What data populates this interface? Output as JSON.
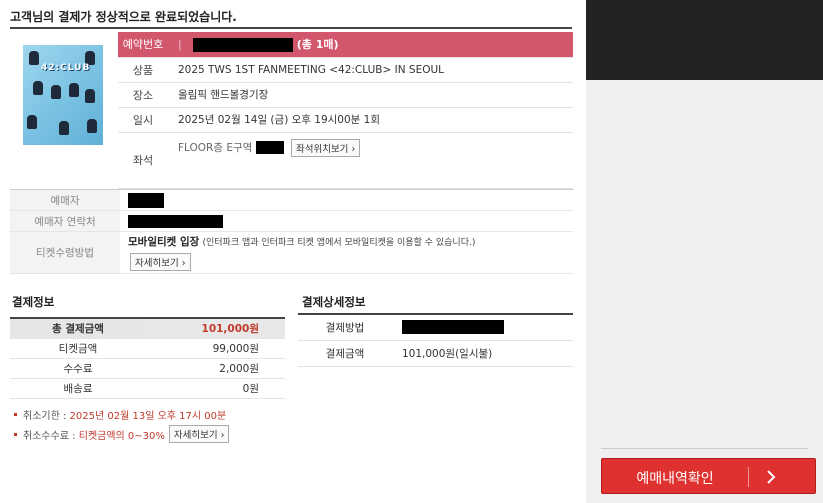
{
  "heading": "고객님의 결제가 정상적으로 완료되었습니다.",
  "poster": {
    "title": "42:CLUB"
  },
  "booking": {
    "number_label": "예약번호",
    "count_text": "(총 1매)",
    "rows": [
      {
        "label": "상품",
        "value": "2025 TWS 1ST FANMEETING <42:CLUB> IN SEOUL"
      },
      {
        "label": "장소",
        "value": "올림픽 핸드볼경기장"
      },
      {
        "label": "일시",
        "value": "2025년 02월 14일 (금) 오후 19시00분 1회"
      }
    ],
    "seat_label": "좌석",
    "seat_value": "FLOOR층 E구역",
    "seat_button": "좌석위치보기"
  },
  "buyer": {
    "name_label": "예매자",
    "contact_label": "예매자 연락처",
    "method_label": "티켓수령방법",
    "method_value": "모바일티켓 입장",
    "method_note": "(인터파크 앱과 인터파크 티켓 앱에서 모바일티켓을 이용할 수 있습니다.)",
    "detail_button": "자세히보기"
  },
  "payment": {
    "title": "결제정보",
    "total_label": "총 결제금액",
    "total_value": "101,000원",
    "rows": [
      {
        "label": "티켓금액",
        "value": "99,000원"
      },
      {
        "label": "수수료",
        "value": "2,000원"
      },
      {
        "label": "배송료",
        "value": "0원"
      }
    ]
  },
  "payment_detail": {
    "title": "결제상세정보",
    "method_label": "결제방법",
    "amount_label": "결제금액",
    "amount_value": "101,000원(일시불)"
  },
  "notes": {
    "cancel_deadline_label": "취소기한 :",
    "cancel_deadline_value": "2025년 02월 13일 오후 17시 00분",
    "cancel_fee_label": "취소수수료 :",
    "cancel_fee_value": "티켓금액의 0~30%",
    "detail_button": "자세히보기"
  },
  "confirm_button": "예매내역확인",
  "colors": {
    "accent": "#d2566c",
    "confirm": "#e03131",
    "price": "#c0392b"
  }
}
